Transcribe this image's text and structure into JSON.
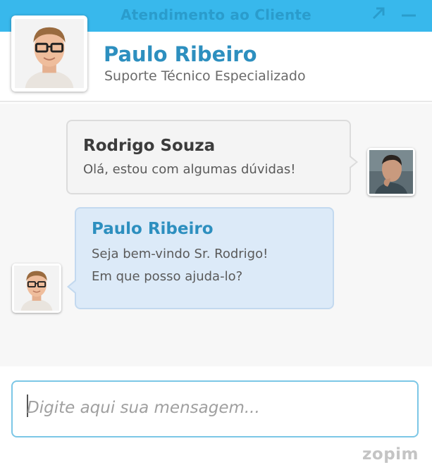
{
  "window": {
    "title": "Atendimento ao Cliente",
    "popout_icon": "popout-arrow-icon",
    "minimize_icon": "minimize-icon"
  },
  "agent": {
    "name": "Paulo Ribeiro",
    "role": "Suporte Técnico Especializado"
  },
  "messages": [
    {
      "sender": "Rodrigo Souza",
      "side": "visitor",
      "lines": [
        "Olá, estou com algumas dúvidas!"
      ]
    },
    {
      "sender": "Paulo Ribeiro",
      "side": "agent",
      "lines": [
        "Seja bem-vindo Sr. Rodrigo!",
        "Em que posso ajuda-lo?"
      ]
    }
  ],
  "input": {
    "value": "",
    "placeholder": "Digite aqui sua mensagem..."
  },
  "footer": {
    "brand": "zopim"
  },
  "colors": {
    "titlebar": "#38b8ec",
    "agent_accent": "#2d8fbf",
    "agent_bubble": "#dceaf8",
    "visitor_bubble": "#f4f4f4"
  }
}
